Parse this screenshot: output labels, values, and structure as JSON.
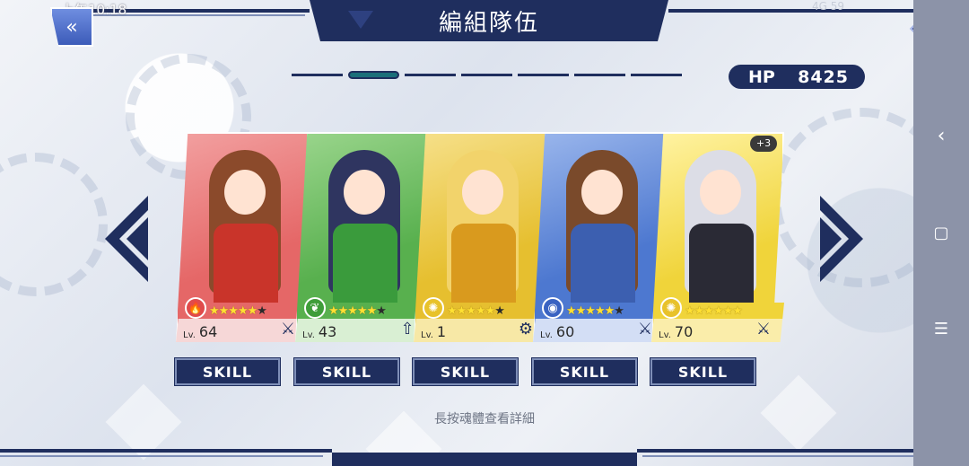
{
  "status_bar": {
    "time": "上午10:18",
    "right_info": "4G  59"
  },
  "header": {
    "title": "編組隊伍",
    "back_icon": "double-chevron-left-icon",
    "back_glyph": "«",
    "close_icon": "close-icon",
    "close_glyph": "×"
  },
  "pager": {
    "total_pages": 7,
    "active_page_index": 1
  },
  "hp": {
    "label": "HP",
    "value": "8425"
  },
  "colors": {
    "navy": "#1f2e5e",
    "fire": "#e04b4b",
    "nature": "#3f9d3a",
    "light": "#e8c22b",
    "water": "#3a63c2"
  },
  "cards": [
    {
      "element": "fire",
      "element_icon": "fire-icon",
      "element_glyph": "🔥",
      "stars_filled": 5,
      "stars_total": 6,
      "level_label": "Lv.",
      "level": "64",
      "type_icon": "sword-icon",
      "type_glyph": "⚔",
      "bg": "#e56767",
      "bg2": "#f2a0a0",
      "info_bg": "#f6d7d7",
      "figure_color": "#8b4a2b",
      "outfit_color": "#c9342a",
      "badge": ""
    },
    {
      "element": "nature",
      "element_icon": "leaf-icon",
      "element_glyph": "❦",
      "stars_filled": 5,
      "stars_total": 6,
      "level_label": "Lv.",
      "level": "43",
      "type_icon": "arrow-up-icon",
      "type_glyph": "⇧",
      "bg": "#58b04e",
      "bg2": "#9ad58c",
      "info_bg": "#d9efd3",
      "figure_color": "#2f3560",
      "outfit_color": "#3a9b3c",
      "badge": ""
    },
    {
      "element": "light",
      "element_icon": "sun-icon",
      "element_glyph": "✺",
      "stars_filled": 5,
      "stars_total": 6,
      "level_label": "Lv.",
      "level": "1",
      "type_icon": "gear-icon",
      "type_glyph": "⚙",
      "bg": "#e6bf2f",
      "bg2": "#f6e08a",
      "info_bg": "#f7e8a6",
      "figure_color": "#f2d36b",
      "outfit_color": "#d99a1e",
      "badge": ""
    },
    {
      "element": "water",
      "element_icon": "water-icon",
      "element_glyph": "◉",
      "stars_filled": 5,
      "stars_total": 6,
      "level_label": "Lv.",
      "level": "60",
      "type_icon": "sword-icon",
      "type_glyph": "⚔",
      "bg": "#4d78d0",
      "bg2": "#9ab6ec",
      "info_bg": "#d3def5",
      "figure_color": "#7a4a2b",
      "outfit_color": "#3c5fb0",
      "badge": ""
    },
    {
      "element": "light",
      "element_icon": "sun-icon",
      "element_glyph": "✺",
      "stars_filled": 6,
      "stars_total": 6,
      "level_label": "Lv.",
      "level": "70",
      "type_icon": "sword-icon",
      "type_glyph": "⚔",
      "bg": "#f0d43a",
      "bg2": "#fff3a3",
      "info_bg": "#faedaa",
      "figure_color": "#dcdde6",
      "outfit_color": "#2a2a35",
      "badge": "+3"
    }
  ],
  "skill_label": "SKILL",
  "hint": "長按魂體查看詳細",
  "nav": {
    "back_glyph": "‹",
    "home_glyph": "▢",
    "menu_glyph": "☰"
  }
}
